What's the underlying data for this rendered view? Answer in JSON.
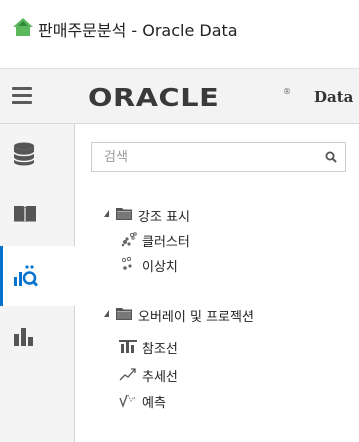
{
  "window": {
    "title": "판매주문분석 - Oracle Data",
    "app_icon": "oracle-house-icon"
  },
  "toolbar": {
    "menu_icon": "hamburger-menu-icon",
    "logo_text": "ORACLE",
    "logo_mark": "®",
    "product_text": "Data"
  },
  "left_nav": {
    "items": [
      {
        "icon": "database-icon",
        "active": false
      },
      {
        "icon": "book-icon",
        "active": false
      },
      {
        "icon": "analytics-icon",
        "active": true
      },
      {
        "icon": "bar-chart-icon",
        "active": false
      }
    ],
    "accent_color": "#0572ce"
  },
  "panel": {
    "search": {
      "placeholder": "검색",
      "value": ""
    },
    "tree": [
      {
        "type": "folder",
        "label": "강조 표시",
        "expanded": true,
        "children": [
          {
            "label": "클러스터",
            "icon": "cluster-icon"
          },
          {
            "label": "이상치",
            "icon": "outlier-icon"
          }
        ]
      },
      {
        "type": "folder",
        "label": "오버레이 및 프로젝션",
        "expanded": true,
        "children": [
          {
            "label": "참조선",
            "icon": "reference-line-icon"
          },
          {
            "label": "추세선",
            "icon": "trend-line-icon"
          },
          {
            "label": "예측",
            "icon": "forecast-icon"
          }
        ]
      }
    ]
  }
}
